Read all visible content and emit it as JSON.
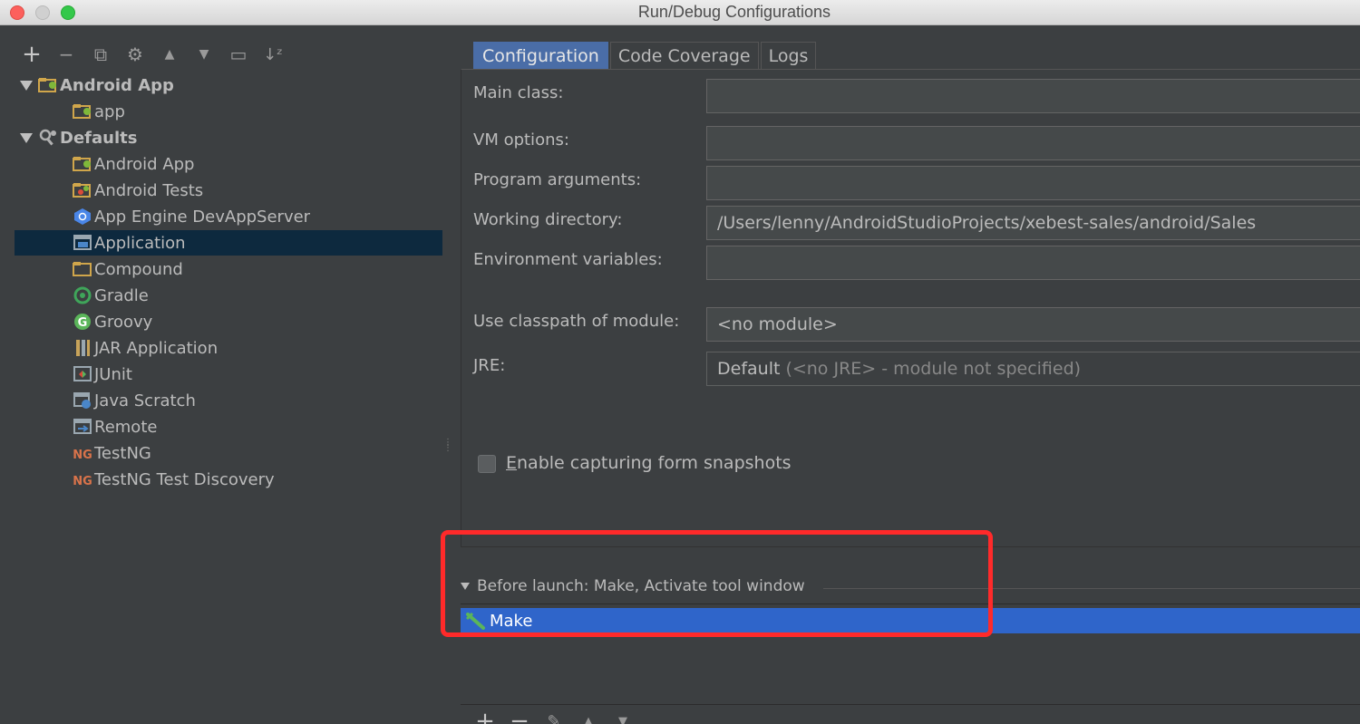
{
  "window": {
    "title": "Run/Debug Configurations"
  },
  "toolbar": {
    "add": "+",
    "remove": "−",
    "copy": "⧉",
    "edit": "⚙",
    "up": "▲",
    "down": "▼",
    "folder": "▭",
    "sort": "↓ᶻ"
  },
  "tree": {
    "groups": [
      {
        "label": "Android App",
        "children": [
          "app"
        ]
      },
      {
        "label": "Defaults",
        "children": [
          "Android App",
          "Android Tests",
          "App Engine DevAppServer",
          "Application",
          "Compound",
          "Gradle",
          "Groovy",
          "JAR Application",
          "JUnit",
          "Java Scratch",
          "Remote",
          "TestNG",
          "TestNG Test Discovery"
        ]
      }
    ],
    "selected": "Application"
  },
  "tabs": [
    "Configuration",
    "Code Coverage",
    "Logs"
  ],
  "form": {
    "main_class_label": "Main class:",
    "main_class_value": "",
    "vm_options_label": "VM options:",
    "vm_options_value": "",
    "program_args_label": "Program arguments:",
    "program_args_value": "",
    "working_dir_label": "Working directory:",
    "working_dir_value": "/Users/lenny/AndroidStudioProjects/xebest-sales/android/Sales",
    "env_vars_label": "Environment variables:",
    "env_vars_value": "",
    "classpath_label": "Use classpath of module:",
    "classpath_value": "<no module>",
    "jre_label": "JRE:",
    "jre_value": "Default",
    "jre_hint": "(<no JRE> - module not specified)",
    "snapshots_mnemonic": "E",
    "snapshots_rest": "nable capturing form snapshots",
    "snapshots_checked": false
  },
  "before_launch": {
    "header": "Before launch: Make, Activate tool window",
    "items": [
      "Make"
    ],
    "toolbar": {
      "add": "+",
      "remove": "−",
      "edit": "✎",
      "up": "▲",
      "down": "▼"
    }
  },
  "colors": {
    "highlight": "#ff2a2a",
    "selection": "#2f65ca",
    "active_tab": "#4a6da7"
  }
}
